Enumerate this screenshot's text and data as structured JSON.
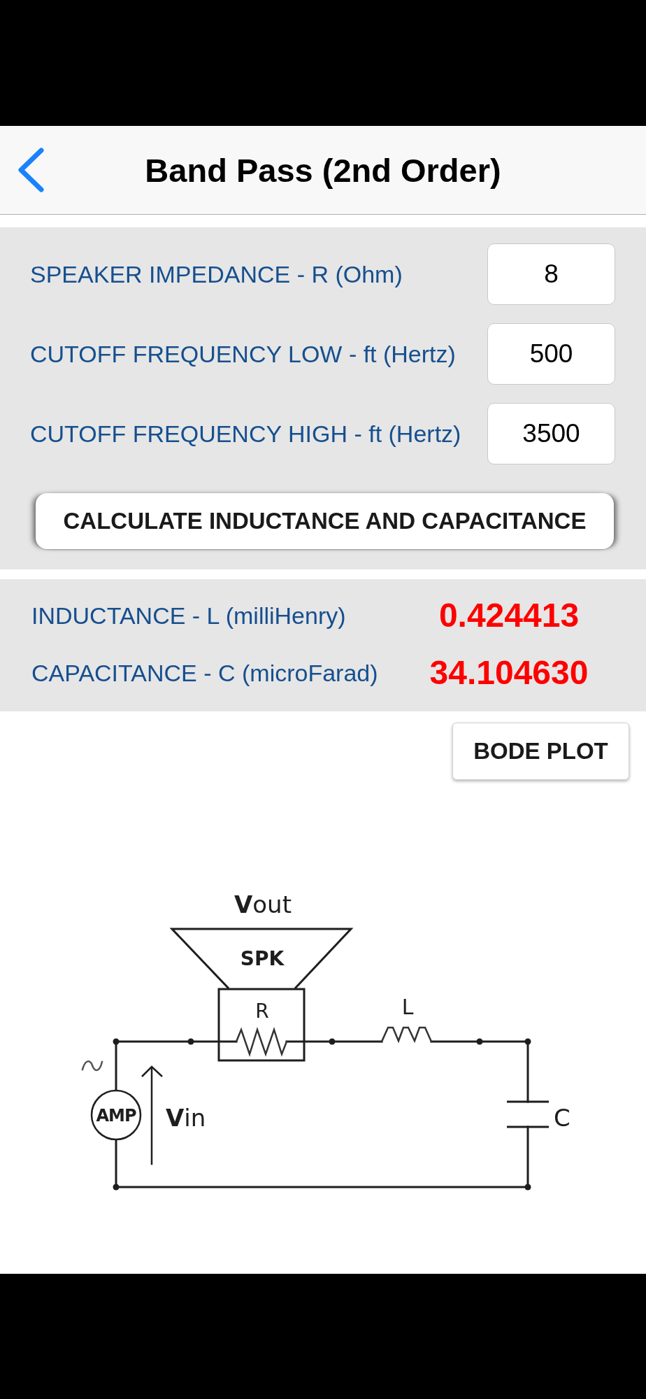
{
  "navigation_bar": {
    "title": "Band Pass (2nd Order)"
  },
  "inputs": [
    {
      "label": "SPEAKER IMPEDANCE - R (Ohm)",
      "value": "8"
    },
    {
      "label": "CUTOFF FREQUENCY LOW - ft (Hertz)",
      "value": "500"
    },
    {
      "label": "CUTOFF FREQUENCY HIGH - ft (Hertz)",
      "value": "3500"
    }
  ],
  "calculate_button": "CALCULATE INDUCTANCE AND CAPACITANCE",
  "results": [
    {
      "label": "INDUCTANCE - L (milliHenry)",
      "value": "0.424413"
    },
    {
      "label": "CAPACITANCE - C (microFarad)",
      "value": "34.104630"
    }
  ],
  "bode_plot_button": "BODE PLOT",
  "circuit_diagram": {
    "output_label": "**V**out",
    "speaker_label": "SPK",
    "resistor_label": "R",
    "inductor_label": "L",
    "capacitor_label": "C",
    "source_label": "AMP",
    "input_label": "**V**in"
  }
}
